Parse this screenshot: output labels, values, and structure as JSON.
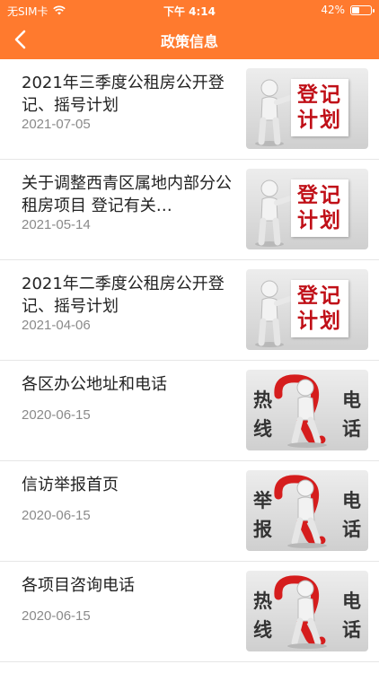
{
  "status_bar": {
    "carrier": "无SIM卡",
    "time": "下午 4:14",
    "battery_percent": "42%",
    "battery_level": 0.42
  },
  "nav": {
    "title": "政策信息",
    "back_icon": "chevron-left-icon"
  },
  "colors": {
    "accent": "#ff7a2e",
    "date_text": "#8a8a8a",
    "sign_red": "#c01018"
  },
  "items": [
    {
      "title": "2021年三季度公租房公开登记、摇号计划",
      "date": "2021-07-05",
      "thumb": {
        "type": "sign",
        "line1": "登记",
        "line2": "计划"
      }
    },
    {
      "title": "关于调整西青区属地内部分公租房项目 登记有关…",
      "date": "2021-05-14",
      "thumb": {
        "type": "sign",
        "line1": "登记",
        "line2": "计划"
      }
    },
    {
      "title": "2021年二季度公租房公开登记、摇号计划",
      "date": "2021-04-06",
      "thumb": {
        "type": "sign",
        "line1": "登记",
        "line2": "计划"
      }
    },
    {
      "title": "各区办公地址和电话",
      "date": "2020-06-15",
      "thumb": {
        "type": "phone",
        "left1": "热",
        "left2": "线",
        "right1": "电",
        "right2": "话"
      }
    },
    {
      "title": "信访举报首页",
      "date": "2020-06-15",
      "thumb": {
        "type": "phone",
        "left1": "举",
        "left2": "报",
        "right1": "电",
        "right2": "话"
      }
    },
    {
      "title": "各项目咨询电话",
      "date": "2020-06-15",
      "thumb": {
        "type": "phone",
        "left1": "热",
        "left2": "线",
        "right1": "电",
        "right2": "话"
      }
    }
  ]
}
